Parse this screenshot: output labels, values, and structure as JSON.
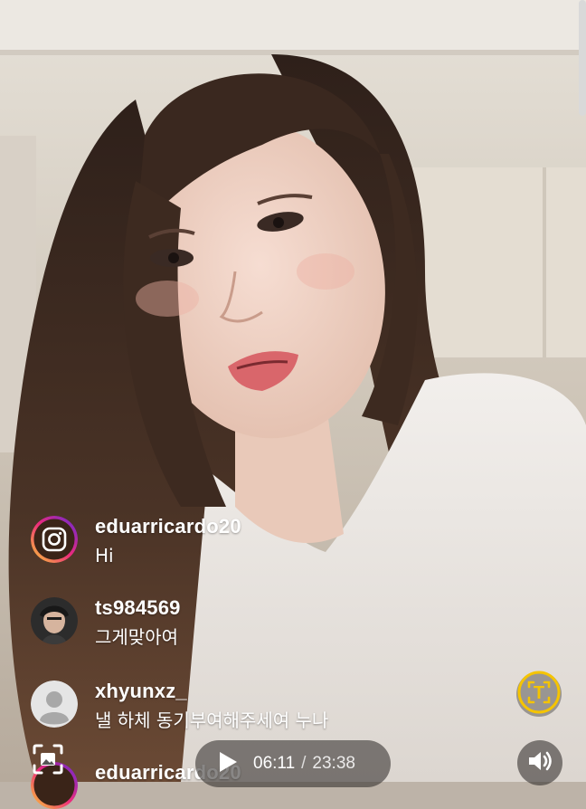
{
  "player": {
    "current_time": "06:11",
    "separator": "/",
    "duration": "23:38",
    "progress_fraction": 0.2617
  },
  "comments": [
    {
      "username": "eduarricardo20",
      "message": "Hi",
      "avatar_icon": "instagram-icon"
    },
    {
      "username": "ts984569",
      "message": "그게맞아여",
      "avatar_icon": "user-photo-avatar"
    },
    {
      "username": "xhyunxz_",
      "message": "낼 하체 동기부여해주세여 누나",
      "avatar_icon": "default-user-icon"
    },
    {
      "username": "eduarricardo20",
      "message": "",
      "avatar_icon": "instagram-icon"
    }
  ],
  "colors": {
    "accent_yellow": "#f5c400",
    "instagram_gradient": [
      "#f9ce34",
      "#ee2a7b",
      "#6228d7"
    ]
  }
}
